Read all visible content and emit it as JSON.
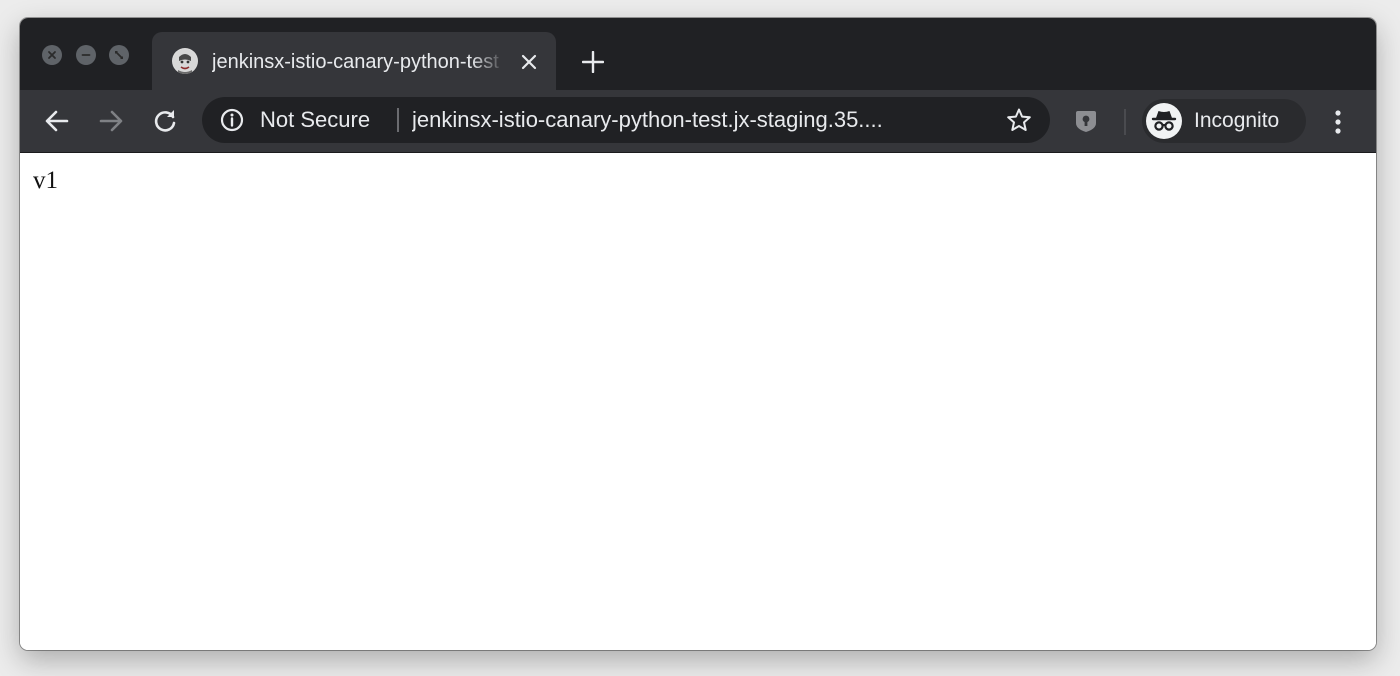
{
  "window": {
    "controls": [
      "close",
      "minimize",
      "fullscreen"
    ]
  },
  "tab": {
    "title": "jenkinsx-istio-canary-python-test",
    "favicon": "jenkins-icon",
    "close": "close-icon"
  },
  "toolbar": {
    "back": "back-arrow-icon",
    "forward": "forward-arrow-icon",
    "reload": "reload-icon",
    "security_label": "Not Secure",
    "url": "jenkinsx-istio-canary-python-test.jx-staging.35....",
    "bookmark": "star-icon",
    "extension": "password-manager-icon",
    "incognito_label": "Incognito",
    "menu": "more-vert-icon"
  },
  "page": {
    "body_text": "v1"
  },
  "colors": {
    "titlebar": "#202124",
    "toolbar": "#35363a",
    "omnibox": "#202124",
    "text_light": "#e8eaed",
    "page_bg": "#ffffff"
  }
}
